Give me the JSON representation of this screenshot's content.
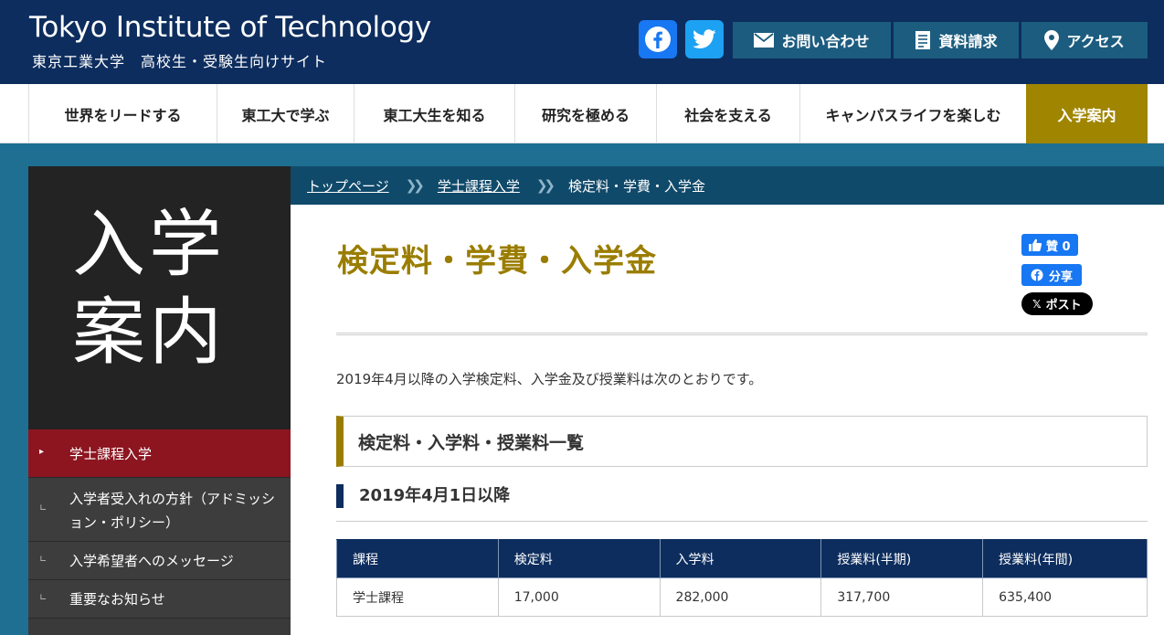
{
  "header": {
    "title": "Tokyo Institute of Technology",
    "subtitle": "東京工業大学　高校生・受験生向けサイト",
    "buttons": {
      "contact": "お問い合わせ",
      "request": "資料請求",
      "access": "アクセス"
    }
  },
  "nav": {
    "items": [
      "世界をリードする",
      "東工大で学ぶ",
      "東工大生を知る",
      "研究を極める",
      "社会を支える",
      "キャンパスライフを楽しむ",
      "入学案内"
    ],
    "active": "入学案内"
  },
  "sidebar": {
    "hero": "入学案内",
    "items": [
      {
        "label": "学士課程入学",
        "active": true
      },
      {
        "label": "入学者受入れの方針（アドミッション・ポリシー）",
        "active": false
      },
      {
        "label": "入学希望者へのメッセージ",
        "active": false
      },
      {
        "label": "重要なお知らせ",
        "active": false
      }
    ]
  },
  "breadcrumb": {
    "items": [
      "トップページ",
      "学士課程入学",
      "検定料・学費・入学金"
    ]
  },
  "social": {
    "like": "贊 0",
    "share": "分享",
    "post": "ポスト"
  },
  "main": {
    "title": "検定料・学費・入学金",
    "intro": "2019年4月以降の入学検定料、入学金及び授業料は次のとおりです。",
    "section_heading": "検定料・入学料・授業料一覧",
    "subsection_heading": "2019年4月1日以降",
    "table": {
      "headers": [
        "課程",
        "検定料",
        "入学料",
        "授業料(半期)",
        "授業料(年間)"
      ],
      "rows": [
        [
          "学士課程",
          "17,000",
          "282,000",
          "317,700",
          "635,400"
        ]
      ]
    }
  },
  "colors": {
    "header_bg": "#0d2d5e",
    "accent_gold": "#9a7d00",
    "active_red": "#8c1520",
    "breadcrumb_bg": "#104a6a"
  }
}
